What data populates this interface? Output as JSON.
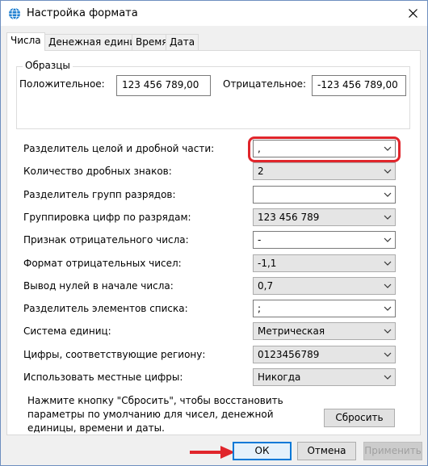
{
  "window": {
    "title": "Настройка формата"
  },
  "tabs": [
    {
      "label": "Числа",
      "active": true
    },
    {
      "label": "Денежная единица",
      "active": false
    },
    {
      "label": "Время",
      "active": false
    },
    {
      "label": "Дата",
      "active": false
    }
  ],
  "samples": {
    "group_title": "Образцы",
    "positive_label": "Положительное:",
    "positive_value": "123 456 789,00",
    "negative_label": "Отрицательное:",
    "negative_value": "-123 456 789,00"
  },
  "settings": [
    {
      "label": "Разделитель целой и дробной части:",
      "value": ",",
      "editable": true,
      "highlighted": true
    },
    {
      "label": "Количество дробных знаков:",
      "value": "2",
      "editable": false
    },
    {
      "label": "Разделитель групп разрядов:",
      "value": "",
      "editable": true
    },
    {
      "label": "Группировка цифр по разрядам:",
      "value": "123 456 789",
      "editable": false
    },
    {
      "label": "Признак отрицательного числа:",
      "value": "-",
      "editable": true
    },
    {
      "label": "Формат отрицательных чисел:",
      "value": "-1,1",
      "editable": false
    },
    {
      "label": "Вывод нулей в начале числа:",
      "value": "0,7",
      "editable": false
    },
    {
      "label": "Разделитель элементов списка:",
      "value": ";",
      "editable": true
    },
    {
      "label": "Система единиц:",
      "value": "Метрическая",
      "editable": false
    },
    {
      "label": "Цифры, соответствующие региону:",
      "value": "0123456789",
      "editable": false
    },
    {
      "label": "Использовать местные цифры:",
      "value": "Никогда",
      "editable": false
    }
  ],
  "info": {
    "text": "Нажмите кнопку \"Сбросить\", чтобы восстановить параметры по умолчанию для чисел, денежной единицы, времени и даты.",
    "reset_label": "Сбросить"
  },
  "buttons": {
    "ok": "ОК",
    "cancel": "Отмена",
    "apply": "Применить"
  },
  "colors": {
    "highlight": "#e0252b",
    "accent": "#0078d7",
    "icon": "#1e7fd1"
  },
  "icons": [
    "globe-icon",
    "close-icon",
    "chevron-down-icon",
    "red-arrow-icon"
  ]
}
